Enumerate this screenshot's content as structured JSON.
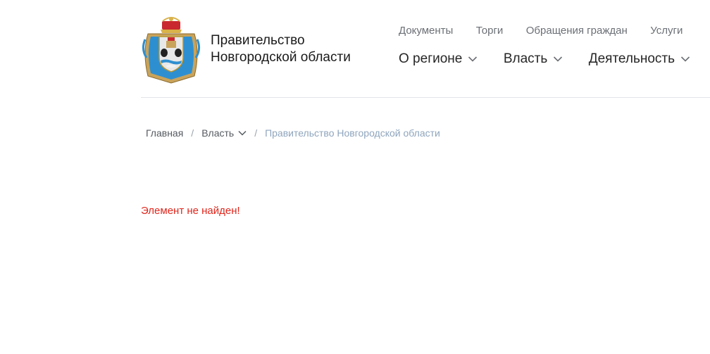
{
  "header": {
    "site_title_line1": "Правительство",
    "site_title_line2": "Новгородской области",
    "top_nav": [
      {
        "label": "Документы"
      },
      {
        "label": "Торги"
      },
      {
        "label": "Обращения граждан"
      },
      {
        "label": "Услуги"
      }
    ],
    "main_nav": [
      {
        "label": "О регионе"
      },
      {
        "label": "Власть"
      },
      {
        "label": "Деятельность"
      }
    ]
  },
  "breadcrumb": {
    "home": "Главная",
    "section": "Власть",
    "current": "Правительство Новгородской области",
    "separator": "/"
  },
  "main": {
    "error_message": "Элемент не найден!"
  },
  "colors": {
    "error": "#e0261c",
    "breadcrumb_current": "#8fa5bd",
    "divider": "#e1e4e8"
  }
}
